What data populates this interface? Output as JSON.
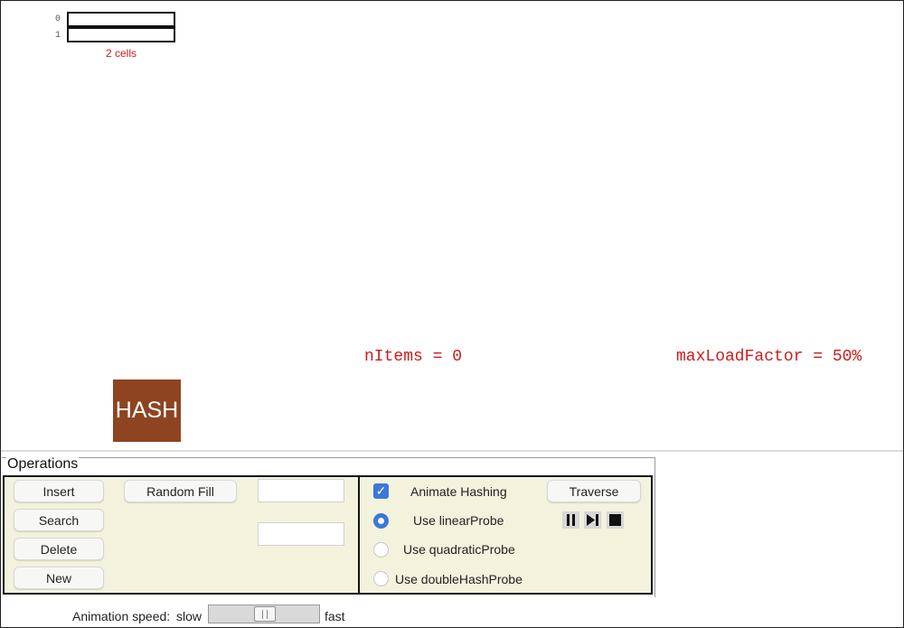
{
  "table": {
    "indices": [
      "0",
      "1"
    ],
    "cells_label": "2 cells"
  },
  "stats": {
    "n_items": "nItems = 0",
    "max_load_factor": "maxLoadFactor = 50%"
  },
  "hash_box_label": "HASH",
  "operations": {
    "legend": "Operations",
    "insert_label": "Insert",
    "search_label": "Search",
    "delete_label": "Delete",
    "new_label": "New",
    "random_fill_label": "Random Fill",
    "input_top_value": "",
    "input_bottom_value": "",
    "animate_hashing_label": "Animate Hashing",
    "animate_hashing_checked": true,
    "traverse_label": "Traverse",
    "probe_options": [
      {
        "label": "Use linearProbe",
        "selected": true
      },
      {
        "label": "Use quadraticProbe",
        "selected": false
      },
      {
        "label": "Use doubleHashProbe",
        "selected": false
      }
    ],
    "controls": [
      "pause-icon",
      "step-icon",
      "stop-icon"
    ]
  },
  "speed": {
    "label": "Animation speed:",
    "slow": "slow",
    "fast": "fast",
    "value": 0.5
  },
  "colors": {
    "accent_red": "#d11a1a",
    "hash_brown": "#8e4420",
    "panel_bg": "#f3f2dd",
    "checkbox_blue": "#3b78d8"
  }
}
